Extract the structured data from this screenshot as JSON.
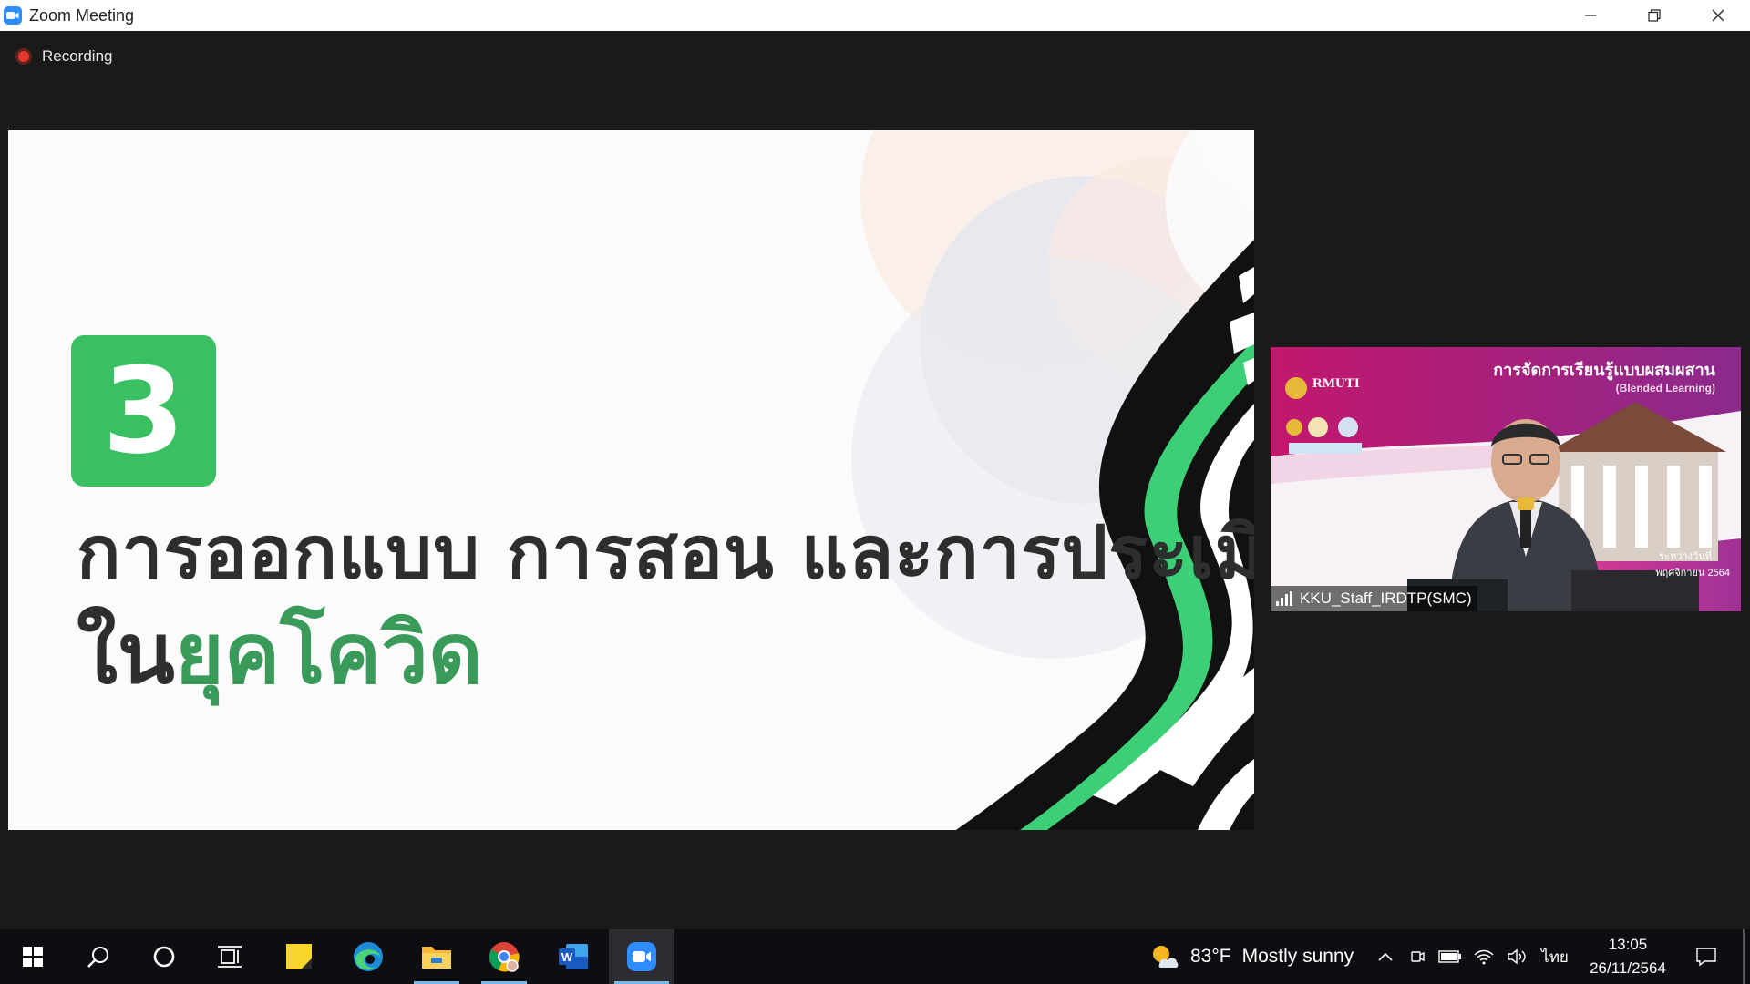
{
  "window": {
    "title": "Zoom Meeting"
  },
  "meeting": {
    "recording_label": "Recording",
    "shared_slide": {
      "number": "3",
      "line1": "การออกแบบ การสอน และการประเมิน",
      "line2_dark": "ใน",
      "line2_green": "ยุคโควิด",
      "accent_color": "#3ac063"
    },
    "participant": {
      "name": "KKU_Staff_IRDTP(SMC)",
      "banner_title": "การจัดการเรียนรู้แบบผสมผสาน",
      "banner_subtitle": "(Blended Learning)",
      "logo_text": "RMUTI",
      "date_line1": "ระหว่างวันที่",
      "date_line2": "พฤศจิกายน 2564"
    }
  },
  "taskbar": {
    "apps": [
      "start-icon",
      "search-icon",
      "cortana-icon",
      "task-view-icon",
      "sticky-notes-icon",
      "edge-icon",
      "file-explorer-icon",
      "chrome-icon",
      "word-icon",
      "zoom-icon"
    ],
    "weather_temp": "83°F",
    "weather_desc": "Mostly sunny",
    "language": "ไทย",
    "time": "13:05",
    "date": "26/11/2564"
  }
}
